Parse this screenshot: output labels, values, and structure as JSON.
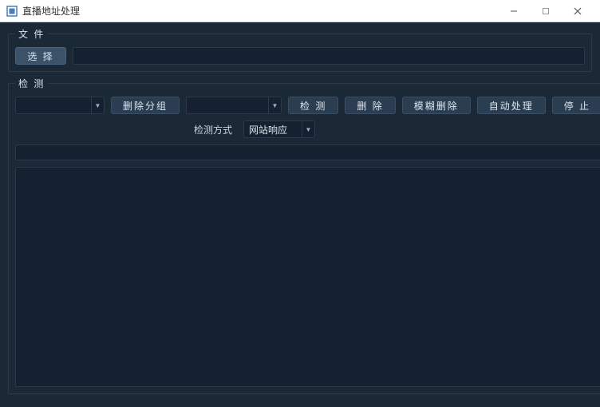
{
  "window": {
    "title": "直播地址处理"
  },
  "file_group": {
    "legend": "文 件",
    "choose_label": "选 择",
    "path_value": ""
  },
  "detect_group": {
    "legend": "检 测",
    "dropdown1_value": "",
    "delete_group_label": "删除分组",
    "dropdown2_value": "",
    "detect_label": "检 测",
    "delete_label": "删 除",
    "fuzzy_delete_label": "模糊删除",
    "auto_process_label": "自动处理",
    "stop_label": "停 止",
    "method_label": "检测方式",
    "method_value": "网站响应",
    "result_value": "",
    "log_value": ""
  }
}
